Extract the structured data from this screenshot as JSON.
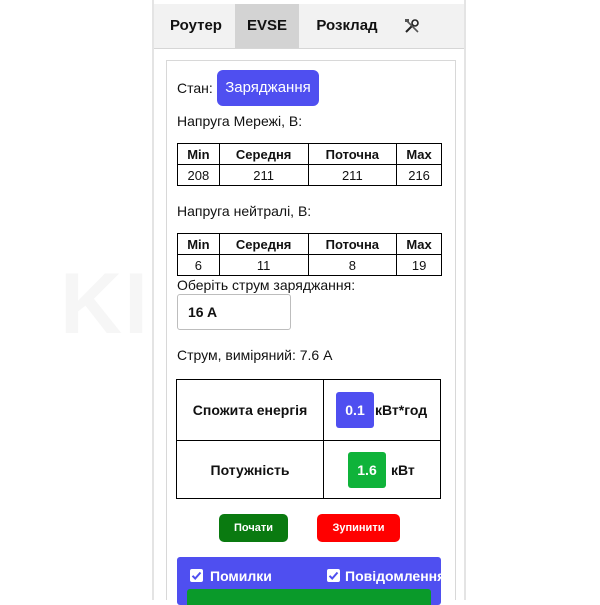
{
  "tabs": [
    {
      "label": "Роутер",
      "active": false
    },
    {
      "label": "EVSE",
      "active": true
    },
    {
      "label": "Розклад",
      "active": false
    }
  ],
  "tools_icon": "wrench-screwdriver-icon",
  "state": {
    "label": "Стан:",
    "value": "Заряджання"
  },
  "grid_voltage": {
    "title": "Напруга Мережі, В:",
    "headers": [
      "Min",
      "Середня",
      "Поточна",
      "Max"
    ],
    "values": [
      "208",
      "211",
      "211",
      "216"
    ]
  },
  "neutral_voltage": {
    "title": "Напруга нейтралі, В:",
    "headers": [
      "Min",
      "Середня",
      "Поточна",
      "Max"
    ],
    "values": [
      "6",
      "11",
      "8",
      "19"
    ]
  },
  "current_select": {
    "label": "Оберіть струм заряджання:",
    "value": "16 A"
  },
  "measured_current": "Струм, виміряний: 7.6 A",
  "energy": {
    "label": "Спожита енергія",
    "value": "0.1",
    "unit": "кВт*год"
  },
  "power": {
    "label": "Потужність",
    "value": "1.6",
    "unit": "кВт"
  },
  "buttons": {
    "start": "Почати",
    "stop": "Зупинити"
  },
  "footer": {
    "errors": "Помилки",
    "notifications": "Повідомлення"
  },
  "watermark": "KIENGUA",
  "colors": {
    "accent_blue": "#4f4ff0",
    "green": "#0a9a2a",
    "red": "#ff0000",
    "dark_green": "#0a7a10"
  }
}
